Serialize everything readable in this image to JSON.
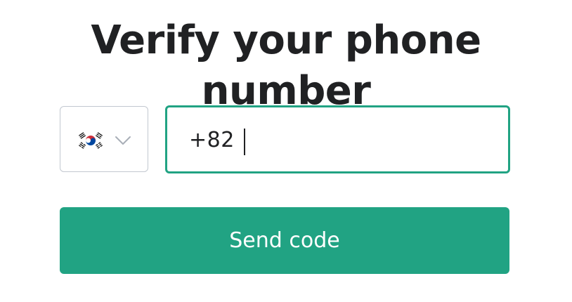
{
  "header": {
    "title": "Verify your phone number"
  },
  "country_select": {
    "flag_icon": "south-korea-flag-icon",
    "dropdown_icon": "chevron-down-icon"
  },
  "phone_field": {
    "value": "+82"
  },
  "send_button": {
    "label": "Send code"
  },
  "colors": {
    "accent": "#21a383",
    "text": "#202123",
    "border": "#c2c8d0",
    "background": "#ffffff"
  }
}
